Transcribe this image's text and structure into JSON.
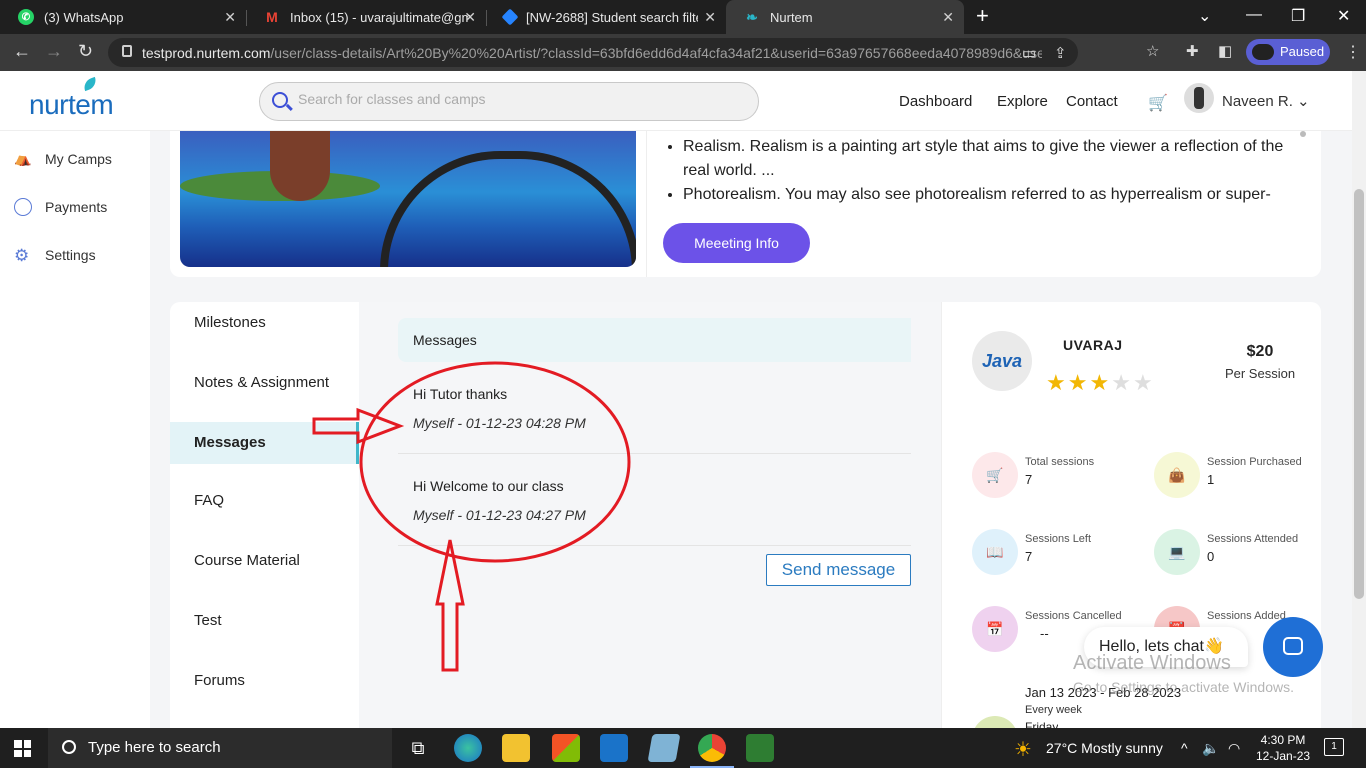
{
  "browser": {
    "tabs": [
      {
        "title": "(3) WhatsApp",
        "icon": "whatsapp-icon",
        "color": "#25d366"
      },
      {
        "title": "Inbox (15) - uvarajultimate@gma",
        "icon": "gmail-icon",
        "color": "#ea4335"
      },
      {
        "title": "[NW-2688] Student search filter r",
        "icon": "jira-icon",
        "color": "#2684ff"
      },
      {
        "title": "Nurtem",
        "icon": "nurtem-icon",
        "color": "#29b6c9"
      }
    ],
    "url_host": "testprod.nurtem.com",
    "url_path": "/user/class-details/Art%20By%20%20Artist/?classId=63bfd6edd6d4af4cfa34af21&userid=63a97657668eeda4078989d6&userty...",
    "profile_status": "Paused"
  },
  "header": {
    "logo": "nurtem",
    "search_placeholder": "Search for classes and camps",
    "nav": [
      "Dashboard",
      "Explore",
      "Contact"
    ],
    "user_name": "Naveen R."
  },
  "sidebar": {
    "items": [
      {
        "label": "My Camps",
        "icon": "camps-icon"
      },
      {
        "label": "Payments",
        "icon": "payments-icon"
      },
      {
        "label": "Settings",
        "icon": "gear-icon"
      }
    ]
  },
  "class_info": {
    "bullets": [
      "Realism. Realism is a painting art style that aims to give the viewer a reflection of the real world. ...",
      "Photorealism. You may also see photorealism referred to as hyperrealism or super-"
    ],
    "meeting_button": "Meeeting Info"
  },
  "tabs": [
    {
      "label": "Milestones",
      "active": false
    },
    {
      "label": "Notes & Assignment",
      "active": false
    },
    {
      "label": "Messages",
      "active": true
    },
    {
      "label": "FAQ",
      "active": false
    },
    {
      "label": "Course Material",
      "active": false
    },
    {
      "label": "Test",
      "active": false
    },
    {
      "label": "Forums",
      "active": false
    }
  ],
  "messages": {
    "header": "Messages",
    "items": [
      {
        "text": "Hi Tutor thanks",
        "meta": "Myself - 01-12-23 04:28 PM"
      },
      {
        "text": "Hi Welcome to our class",
        "meta": "Myself - 01-12-23 04:27 PM"
      }
    ],
    "send_button": "Send message"
  },
  "tutor": {
    "logo_text": "Java",
    "name": "UVARAJ",
    "rating": 3,
    "rating_max": 5,
    "price": "$20",
    "price_unit": "Per Session"
  },
  "stats": [
    {
      "label": "Total sessions",
      "value": "7",
      "icon": "cart-icon",
      "color": "#fde8ea"
    },
    {
      "label": "Session Purchased",
      "value": "1",
      "icon": "bag-icon",
      "color": "#f6f8d5"
    },
    {
      "label": "Sessions Left",
      "value": "7",
      "icon": "book-icon",
      "color": "#dff1fb"
    },
    {
      "label": "Sessions Attended",
      "value": "0",
      "icon": "laptop-icon",
      "color": "#daf3e4"
    },
    {
      "label": "Sessions Cancelled",
      "value": "--",
      "icon": "calendar-icon",
      "color": "#efd2ef"
    },
    {
      "label": "Sessions Added",
      "value": "",
      "icon": "calendar-plus-icon",
      "color": "#f6c7c7"
    }
  ],
  "schedule": {
    "dates": "Jan 13 2023 - Feb 28 2023",
    "frequency": "Every week",
    "day": "Friday"
  },
  "chat": {
    "greeting": "Hello, lets chat👋"
  },
  "watermark": {
    "line1": "Activate Windows",
    "line2": "Go to Settings to activate Windows."
  },
  "taskbar": {
    "search_placeholder": "Type here to search",
    "weather": "27°C  Mostly sunny",
    "time": "4:30 PM",
    "date": "12-Jan-23",
    "notifications": "1"
  }
}
